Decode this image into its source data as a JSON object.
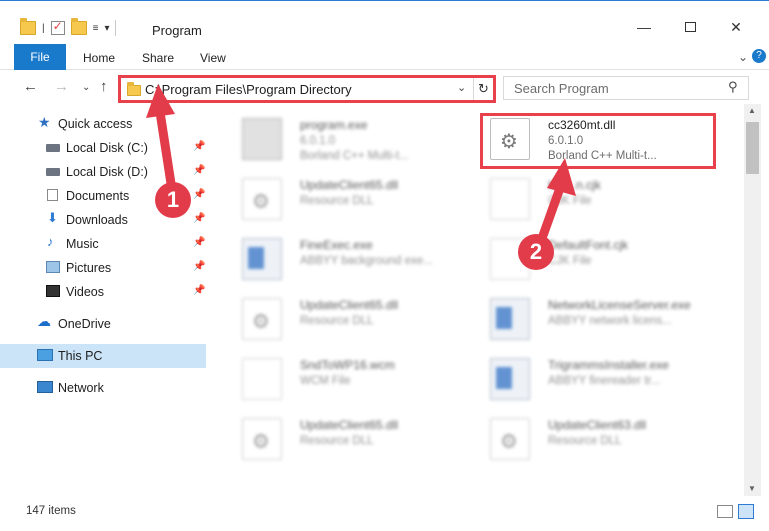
{
  "window": {
    "title": "Program",
    "minimize_glyph": "—",
    "close_glyph": "✕"
  },
  "qat": {
    "pin_glyph": "|",
    "dropdown_glyph": "▾",
    "customize_glyph": "≡"
  },
  "ribbon": {
    "tabs": [
      "File",
      "Home",
      "Share",
      "View"
    ],
    "expand_glyph": "⌄",
    "help_glyph": "?"
  },
  "nav": {
    "back_glyph": "←",
    "forward_glyph": "→",
    "recent_glyph": "⌄",
    "up_glyph": "↑",
    "address": "C:\\Program Files\\Program Directory",
    "address_dropdown_glyph": "⌄",
    "refresh_glyph": "↻",
    "search_placeholder": "Search Program",
    "search_glyph": "⚲"
  },
  "sidebar": {
    "items": [
      {
        "label": "Quick access",
        "icon": "star-icon"
      },
      {
        "label": "Local Disk (C:)",
        "icon": "drive-icon",
        "pinned": true
      },
      {
        "label": "Local Disk (D:)",
        "icon": "drive-icon",
        "pinned": true
      },
      {
        "label": "Documents",
        "icon": "documents-icon",
        "pinned": true
      },
      {
        "label": "Downloads",
        "icon": "download-icon",
        "pinned": true
      },
      {
        "label": "Music",
        "icon": "music-icon",
        "pinned": true
      },
      {
        "label": "Pictures",
        "icon": "pictures-icon",
        "pinned": true
      },
      {
        "label": "Videos",
        "icon": "videos-icon",
        "pinned": true
      },
      {
        "label": "OneDrive",
        "icon": "cloud-icon"
      },
      {
        "label": "This PC",
        "icon": "computer-icon",
        "selected": true
      },
      {
        "label": "Network",
        "icon": "network-icon"
      }
    ],
    "pin_glyph": "📌"
  },
  "files": [
    {
      "name": "program.exe",
      "line2": "6.0.1.0",
      "line3": "Borland C++ Multi-t...",
      "icon": "app-icon",
      "blurred": true
    },
    {
      "name": "cc3260mt.dll",
      "line2": "6.0.1.0",
      "line3": "Borland C++ Multi-t...",
      "icon": "gear-file-icon",
      "blurred": false,
      "highlighted": true
    },
    {
      "name": "UpdateClient65.dll",
      "line2": "Resource DLL",
      "line3": "",
      "icon": "gear-file-icon",
      "blurred": true
    },
    {
      "name": "Kor...n.cjk",
      "line2": "CJK File",
      "line3": "",
      "icon": "blank-file-icon",
      "blurred": true
    },
    {
      "name": "FineExec.exe",
      "line2": "ABBYY background exe...",
      "line3": "",
      "icon": "window-app-icon",
      "blurred": true
    },
    {
      "name": "DefaultFont.cjk",
      "line2": "CJK File",
      "line3": "",
      "icon": "blank-file-icon",
      "blurred": true
    },
    {
      "name": "UpdateClient65.dll",
      "line2": "Resource DLL",
      "line3": "",
      "icon": "gear-file-icon",
      "blurred": true
    },
    {
      "name": "NetworkLicenseServer.exe",
      "line2": "ABBYY network licens...",
      "line3": "",
      "icon": "window-app-icon",
      "blurred": true
    },
    {
      "name": "SndToWP16.wcm",
      "line2": "WCM File",
      "line3": "",
      "icon": "blank-file-icon",
      "blurred": true
    },
    {
      "name": "TrigrammsInstaller.exe",
      "line2": "ABBYY finereader tr...",
      "line3": "",
      "icon": "window-app-icon",
      "blurred": true
    },
    {
      "name": "UpdateClient65.dll",
      "line2": "Resource DLL",
      "line3": "",
      "icon": "gear-file-icon",
      "blurred": true
    },
    {
      "name": "UpdateClient63.dll",
      "line2": "Resource DLL",
      "line3": "",
      "icon": "gear-file-icon",
      "blurred": true
    }
  ],
  "status": {
    "item_count": "147 items"
  },
  "annotations": {
    "badge1": "1",
    "badge2": "2",
    "color": "#e23c4a"
  }
}
